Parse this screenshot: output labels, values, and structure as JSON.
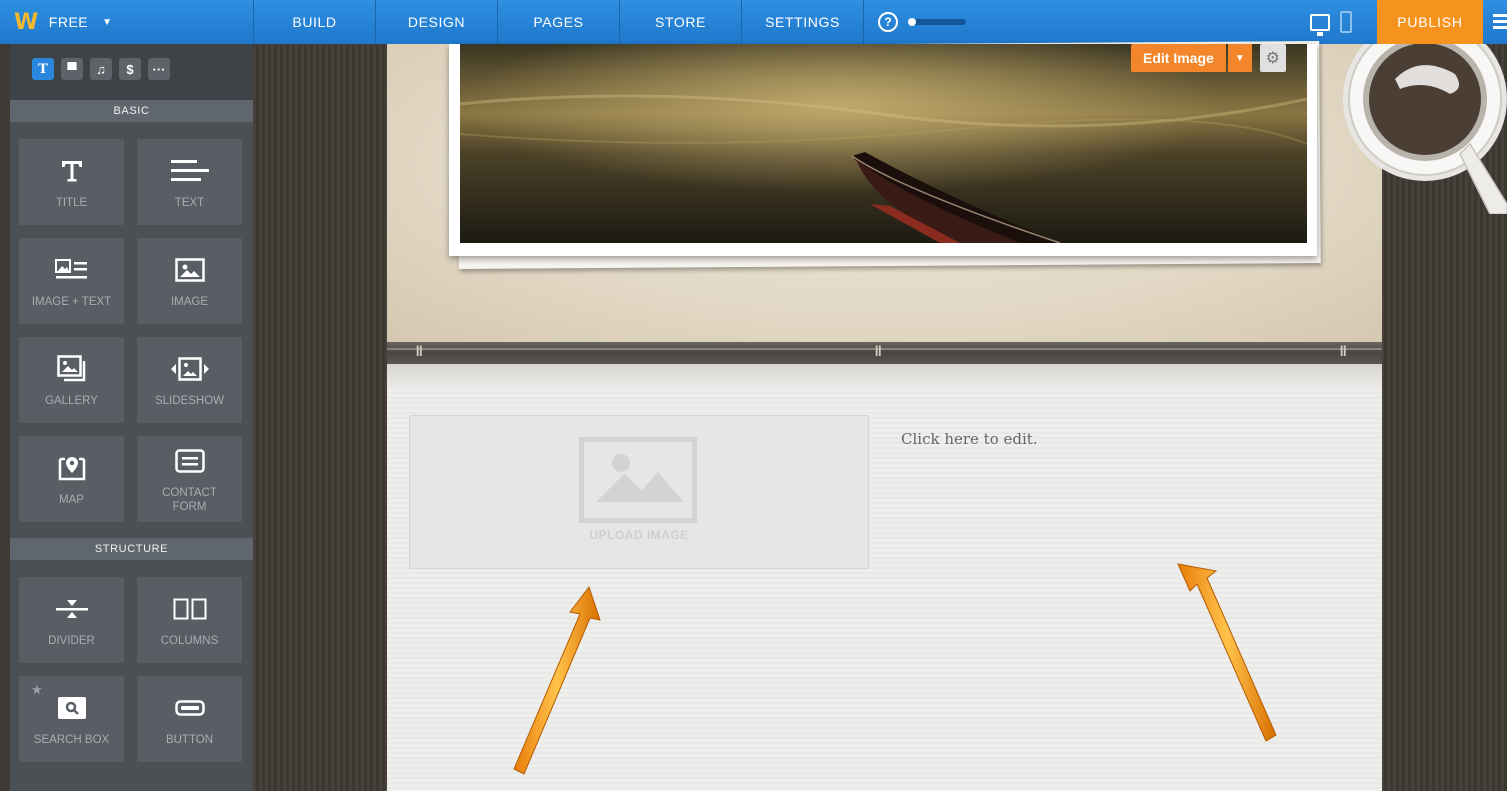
{
  "topbar": {
    "logo": "W",
    "plan_label": "FREE",
    "nav": [
      "BUILD",
      "DESIGN",
      "PAGES",
      "STORE",
      "SETTINGS"
    ],
    "help_glyph": "?",
    "publish_label": "PUBLISH",
    "colors": {
      "bar": "#2f8fe0",
      "publish": "#f6921e",
      "logo": "#f5b82e"
    }
  },
  "sidebar": {
    "tabs": [
      {
        "icon": "text-icon",
        "glyph": "T"
      },
      {
        "icon": "layout-icon",
        "glyph": "▀"
      },
      {
        "icon": "music-icon",
        "glyph": "♫"
      },
      {
        "icon": "dollar-icon",
        "glyph": "$"
      },
      {
        "icon": "more-icon",
        "glyph": "···"
      }
    ],
    "basic_header": "BASIC",
    "basic": [
      {
        "label": "TITLE",
        "icon": "title-icon"
      },
      {
        "label": "TEXT",
        "icon": "text-lines-icon"
      },
      {
        "label": "IMAGE + TEXT",
        "icon": "image-text-icon"
      },
      {
        "label": "IMAGE",
        "icon": "image-icon"
      },
      {
        "label": "GALLERY",
        "icon": "gallery-icon"
      },
      {
        "label": "SLIDESHOW",
        "icon": "slideshow-icon"
      },
      {
        "label": "MAP",
        "icon": "map-pin-icon"
      },
      {
        "label": "CONTACT FORM",
        "icon": "contact-form-icon"
      }
    ],
    "structure_header": "STRUCTURE",
    "structure": [
      {
        "label": "DIVIDER",
        "icon": "divider-icon"
      },
      {
        "label": "COLUMNS",
        "icon": "columns-icon"
      },
      {
        "label": "SEARCH BOX",
        "icon": "search-icon"
      },
      {
        "label": "BUTTON",
        "icon": "button-icon"
      }
    ]
  },
  "canvas": {
    "edit_image_label": "Edit Image",
    "upload_label": "UPLOAD IMAGE",
    "edit_text": "Click here to edit."
  }
}
